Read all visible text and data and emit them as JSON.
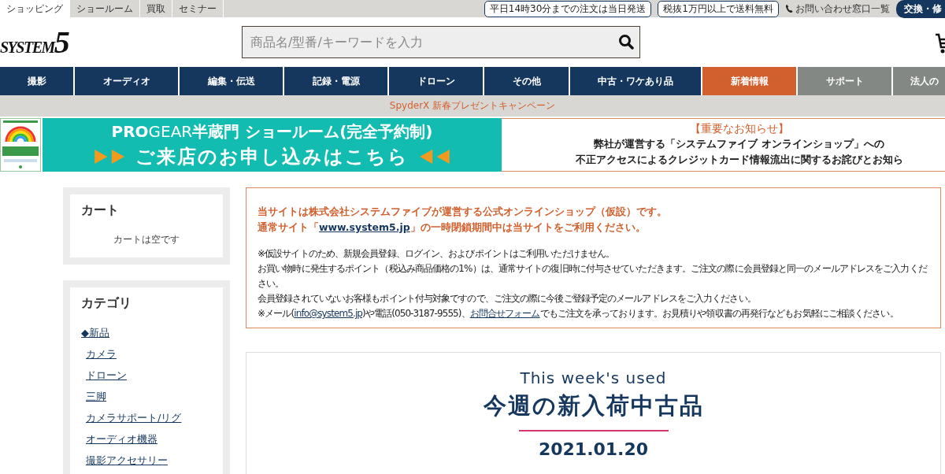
{
  "top_tabs": [
    {
      "label": "ショッピング",
      "selected": true
    },
    {
      "label": "ショールーム",
      "selected": false
    },
    {
      "label": "買取",
      "selected": false
    },
    {
      "label": "セミナー",
      "selected": false
    }
  ],
  "top_badges": [
    "平日14時30分までの注文は当日発送",
    "税抜1万円以上で送料無料"
  ],
  "contact_link": "お問い合わせ窓口一覧",
  "repair_button": "交換・修",
  "logo": {
    "word": "SYSTEM",
    "digit": "5"
  },
  "search": {
    "placeholder": "商品名/型番/キーワードを入力"
  },
  "nav": [
    {
      "label": "撮影",
      "kind": "category"
    },
    {
      "label": "オーディオ",
      "kind": "category"
    },
    {
      "label": "編集・伝送",
      "kind": "category"
    },
    {
      "label": "記録・電源",
      "kind": "category"
    },
    {
      "label": "ドローン",
      "kind": "category"
    },
    {
      "label": "その他",
      "kind": "category"
    },
    {
      "label": "中古・ワケあり品",
      "kind": "category"
    },
    {
      "label": "新着情報",
      "kind": "highlight"
    },
    {
      "label": "サポート",
      "kind": "service"
    },
    {
      "label": "法人の",
      "kind": "service"
    }
  ],
  "campaign": "SpyderX 新春プレゼントキャンペーン",
  "showroom_banner": {
    "line1_brand": "PRO",
    "line1_brand2": "GEAR",
    "line1_rest": "半蔵門 ショールーム(完全予約制)",
    "line2": "ご来店のお申し込みはこちら"
  },
  "important_notice": {
    "title": "【重要なお知らせ】",
    "lines": [
      "弊社が運営する「システムファイブ オンラインショップ」への",
      "不正アクセスによるクレジットカード情報流出に関するお詫びとお知ら"
    ]
  },
  "cart": {
    "title": "カート",
    "empty_text": "カートは空です"
  },
  "categories": {
    "title": "カテゴリ",
    "items": [
      {
        "label": "◆新品",
        "children": [
          {
            "label": "カメラ"
          },
          {
            "label": "ドローン"
          },
          {
            "label": "三脚"
          },
          {
            "label": "カメラサポート/リグ"
          },
          {
            "label": "オーディオ機器"
          },
          {
            "label": "撮影アクセサリー"
          }
        ]
      }
    ]
  },
  "notice": {
    "lead": [
      [
        {
          "kind": "text",
          "text": "当サイトは株式会社システムファイブが運営する公式オンラインショップ（仮設）です。"
        }
      ],
      [
        {
          "kind": "text",
          "text": "通常サイト「"
        },
        {
          "kind": "link",
          "text": "www.system5.jp"
        },
        {
          "kind": "text",
          "text": "」の一時閉鎖期間中は当サイトをご利用ください。"
        }
      ]
    ],
    "body": [
      [
        {
          "kind": "text",
          "text": "※仮設サイトのため、新規会員登録、ログイン、およびポイントはご利用いただけません。"
        }
      ],
      [
        {
          "kind": "text",
          "text": "お買い物時に発生するポイント（税込み商品価格の1%）は、通常サイトの復旧時に付与させていただきます。ご注文の際に会員登録と同一のメールアドレスをご入力ください。"
        }
      ],
      [
        {
          "kind": "text",
          "text": "会員登録されていないお客様もポイント付与対象ですので、ご注文の際に今後ご登録予定のメールアドレスをご入力ください。"
        }
      ],
      [
        {
          "kind": "text",
          "text": "※メール("
        },
        {
          "kind": "link",
          "text": "info@system5.jp"
        },
        {
          "kind": "text",
          "text": ")や電話(050-3187-9555)、"
        },
        {
          "kind": "link",
          "text": "お問合せフォーム"
        },
        {
          "kind": "text",
          "text": "でもご注文を承っております。お見積りや領収書の再発行などもお気軽にご相談ください。"
        }
      ]
    ]
  },
  "feature": {
    "subtitle": "This week's used",
    "title": "今週の新入荷中古品",
    "date": "2021.01.20"
  }
}
